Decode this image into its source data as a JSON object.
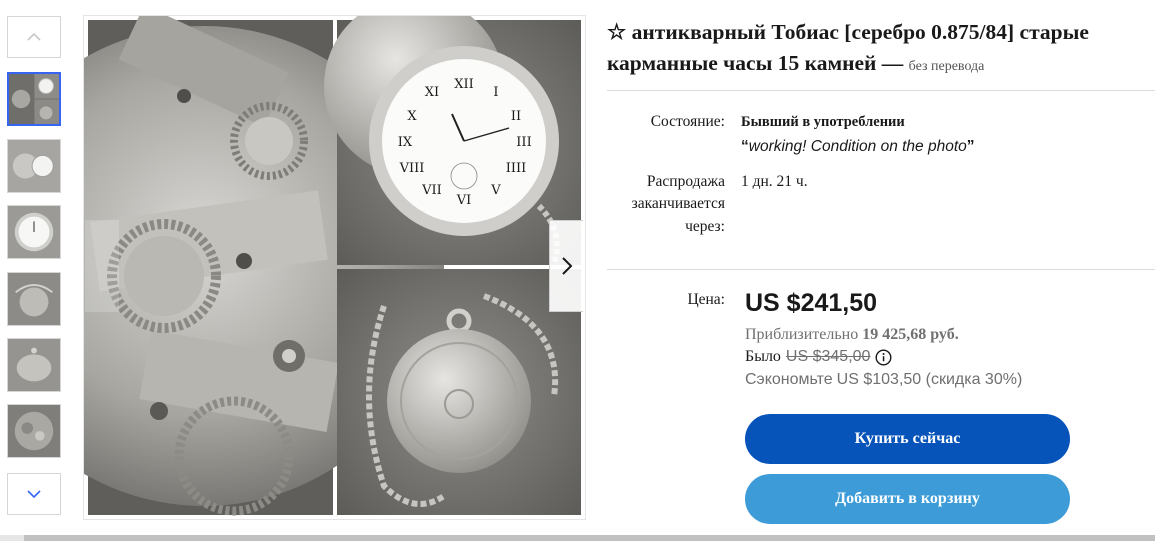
{
  "gallery": {
    "thumbnails": [
      {
        "name": "thumb-collage",
        "active": true
      },
      {
        "name": "thumb-open-watch",
        "active": false
      },
      {
        "name": "thumb-dial",
        "active": false
      },
      {
        "name": "thumb-case-chain",
        "active": false
      },
      {
        "name": "thumb-case-side",
        "active": false
      },
      {
        "name": "thumb-movement",
        "active": false
      }
    ],
    "up_icon": "chevron-up-icon",
    "down_icon": "chevron-down-icon",
    "next_icon": "chevron-right-icon",
    "dial_numerals": [
      "XII",
      "I",
      "II",
      "III",
      "IIII",
      "V",
      "VI",
      "VII",
      "VIII",
      "IX",
      "X",
      "XI"
    ]
  },
  "listing": {
    "title": "☆ антикварный Тобиас [серебро 0.875/84] старые карманные часы 15 камней —",
    "subtitle": "без перевода",
    "condition_label": "Состояние:",
    "condition_value": "Бывший в употреблении",
    "condition_quote_open": "“",
    "condition_note": "working! Condition on the photo",
    "condition_quote_close": "”",
    "ends_label_1": "Распродажа",
    "ends_label_2": "заканчивается",
    "ends_label_3": "через:",
    "ends_value": "1 дн. 21 ч.",
    "price_label": "Цена:",
    "price": "US $241,50",
    "approx_prefix": "Приблизительно",
    "approx_value": "19 425,68 руб.",
    "was_prefix": "Было",
    "was_value": "US $345,00",
    "save_prefix": "Сэкономьте",
    "save_value": "US $103,50 (скидка 30%)",
    "buy_now": "Купить сейчас",
    "add_to_cart": "Добавить в корзину"
  },
  "colors": {
    "buy_button": "#0654ba",
    "cart_button": "#3d9bd8",
    "active_thumb_border": "#3665f3"
  }
}
